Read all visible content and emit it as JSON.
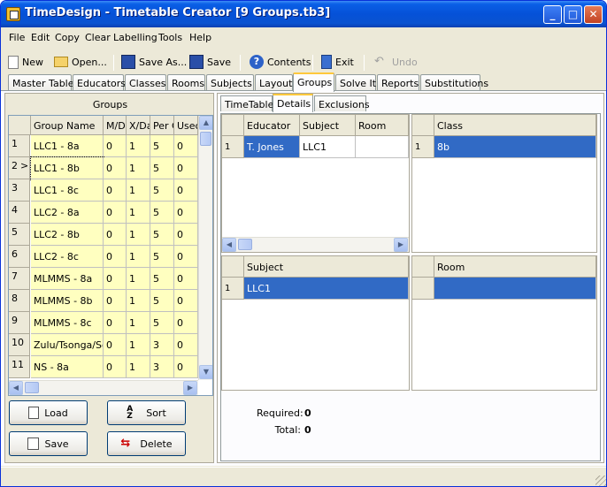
{
  "window": {
    "title": "TimeDesign - Timetable Creator [9 Groups.tb3]",
    "minimize": "_",
    "maximize": "□",
    "close": "✕"
  },
  "menu": [
    "File",
    "Edit",
    "Copy",
    "Clear",
    "Labelling",
    "Tools",
    "Help"
  ],
  "toolbar": {
    "new": "New",
    "open": "Open...",
    "save_as": "Save As...",
    "save": "Save",
    "contents": "Contents",
    "exit": "Exit",
    "undo": "Undo"
  },
  "tabs": [
    "Master Table",
    "Educators",
    "Classes",
    "Rooms",
    "Subjects",
    "Layout",
    "Groups",
    "Solve It",
    "Reports",
    "Substitutions"
  ],
  "active_tab": "Groups",
  "groups_panel": {
    "title": "Groups",
    "columns": [
      "Group Name",
      "M/D",
      "X/Da",
      "Per C",
      "Usec"
    ],
    "rows": [
      {
        "num": "1",
        "marker": "",
        "name": "LLC1 - 8a",
        "md": "0",
        "xd": "1",
        "per": "5",
        "used": "0"
      },
      {
        "num": "2",
        "marker": ">",
        "name": "LLC1 - 8b",
        "md": "0",
        "xd": "1",
        "per": "5",
        "used": "0"
      },
      {
        "num": "3",
        "marker": "",
        "name": "LLC1 - 8c",
        "md": "0",
        "xd": "1",
        "per": "5",
        "used": "0"
      },
      {
        "num": "4",
        "marker": "",
        "name": "LLC2 - 8a",
        "md": "0",
        "xd": "1",
        "per": "5",
        "used": "0"
      },
      {
        "num": "5",
        "marker": "",
        "name": "LLC2 - 8b",
        "md": "0",
        "xd": "1",
        "per": "5",
        "used": "0"
      },
      {
        "num": "6",
        "marker": "",
        "name": "LLC2 - 8c",
        "md": "0",
        "xd": "1",
        "per": "5",
        "used": "0"
      },
      {
        "num": "7",
        "marker": "",
        "name": "MLMMS - 8a",
        "md": "0",
        "xd": "1",
        "per": "5",
        "used": "0"
      },
      {
        "num": "8",
        "marker": "",
        "name": "MLMMS - 8b",
        "md": "0",
        "xd": "1",
        "per": "5",
        "used": "0"
      },
      {
        "num": "9",
        "marker": "",
        "name": "MLMMS - 8c",
        "md": "0",
        "xd": "1",
        "per": "5",
        "used": "0"
      },
      {
        "num": "10",
        "marker": "",
        "name": "Zulu/Tsonga/So",
        "md": "0",
        "xd": "1",
        "per": "3",
        "used": "0"
      },
      {
        "num": "11",
        "marker": "",
        "name": "NS - 8a",
        "md": "0",
        "xd": "1",
        "per": "3",
        "used": "0"
      }
    ],
    "buttons": {
      "load": "Load",
      "sort": "Sort",
      "save": "Save",
      "delete": "Delete"
    }
  },
  "detail_tabs": [
    "TimeTable",
    "Details",
    "Exclusions"
  ],
  "active_detail_tab": "Details",
  "educator_grid": {
    "columns": [
      "Educator",
      "Subject",
      "Room"
    ],
    "rows": [
      {
        "num": "1",
        "educator": "T. Jones",
        "subject": "LLC1",
        "room": ""
      }
    ]
  },
  "class_grid": {
    "columns": [
      "Class"
    ],
    "rows": [
      {
        "num": "1",
        "class": "8b"
      }
    ]
  },
  "subject_grid": {
    "columns": [
      "Subject"
    ],
    "rows": [
      {
        "num": "1",
        "subject": "LLC1"
      }
    ]
  },
  "room_grid": {
    "columns": [
      "Room"
    ],
    "rows": [
      {
        "num": "",
        "room": ""
      }
    ]
  },
  "summary": {
    "required_label": "Required:",
    "required_value": "0",
    "total_label": "Total:",
    "total_value": "0"
  },
  "colors": {
    "title_bar": "#0551d8",
    "selection": "#316ac5",
    "group_cells": "#ffffc0",
    "active_tab_accent": "#ffc83c"
  }
}
